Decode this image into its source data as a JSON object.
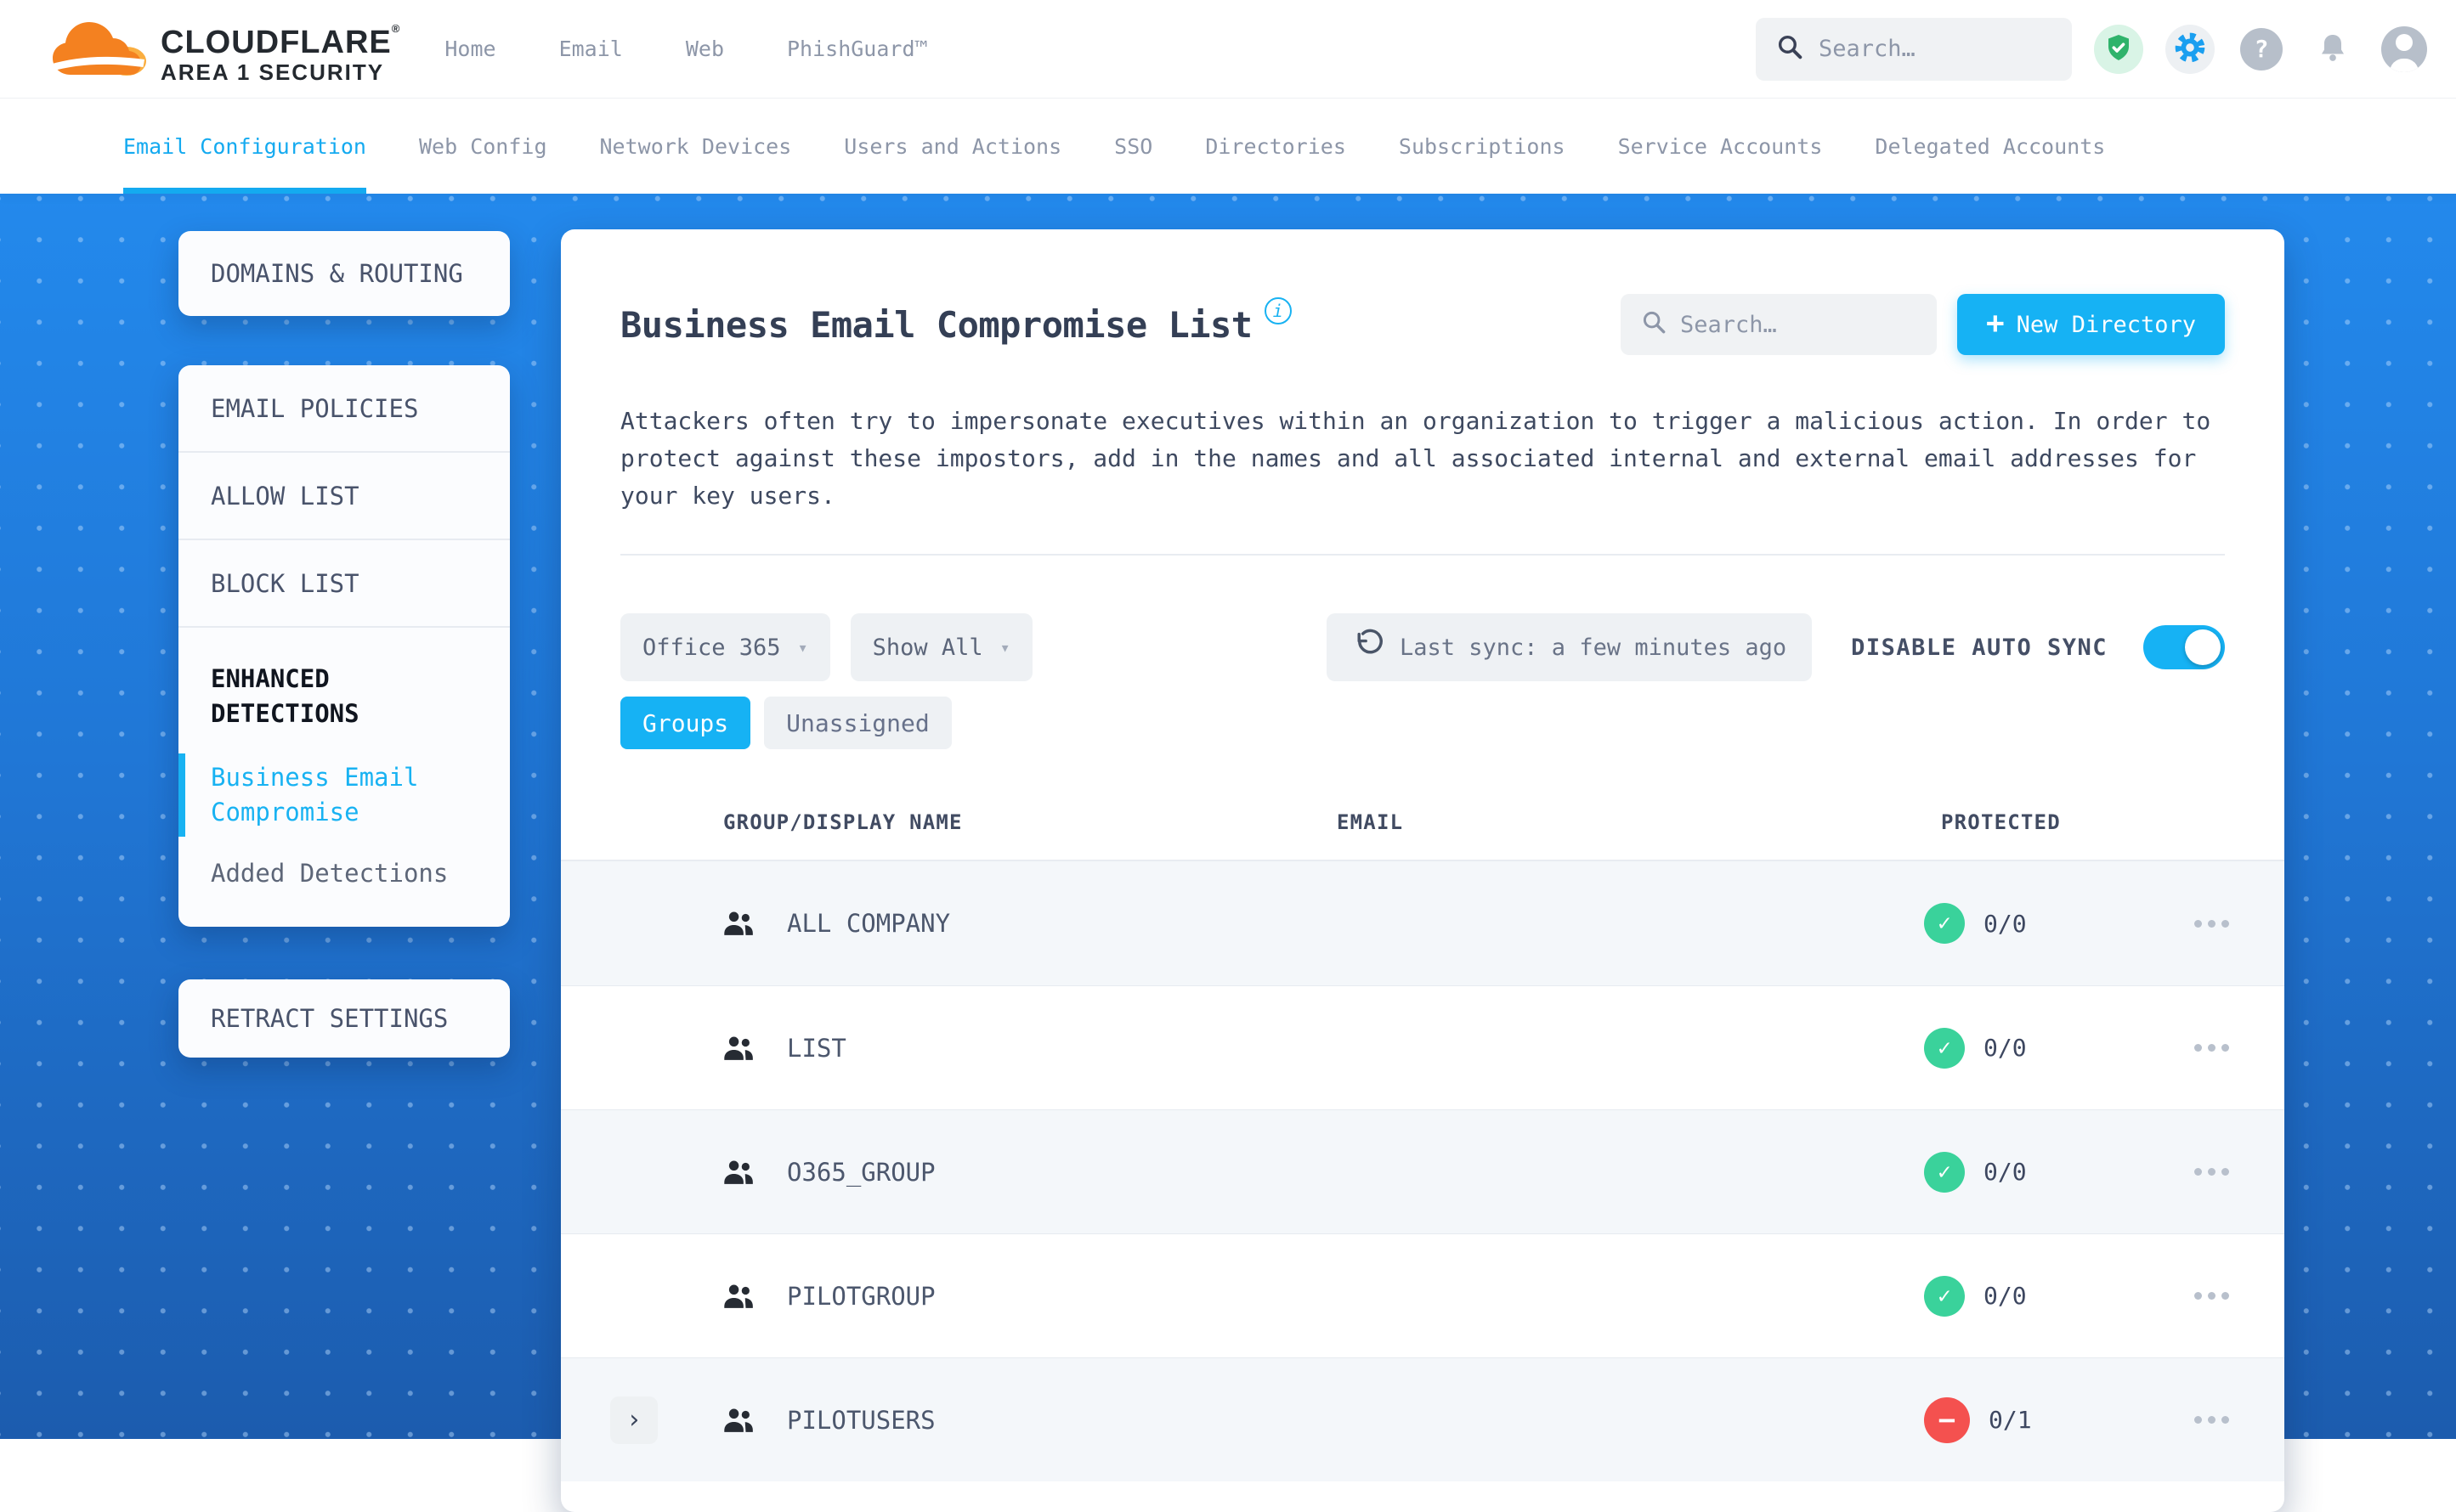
{
  "colors": {
    "accent": "#18b2f2",
    "green": "#3ad29b",
    "red": "#f4514f",
    "bg_top": "#2389ec",
    "bg_bottom": "#1c5cae"
  },
  "icons": {
    "plus": "+",
    "check": "✓",
    "minus": "−",
    "chevron_down": "▾",
    "expander": "›",
    "info": "i",
    "question": "?",
    "reg": "®"
  },
  "topbar": {
    "brand": "CLOUDFLARE",
    "brand_sub": "AREA 1 SECURITY",
    "nav": [
      {
        "label": "Home"
      },
      {
        "label": "Email"
      },
      {
        "label": "Web"
      },
      {
        "label": "PhishGuard™"
      }
    ],
    "search_placeholder": "Search…"
  },
  "tabs": [
    {
      "label": "Email Configuration"
    },
    {
      "label": "Web Config"
    },
    {
      "label": "Network Devices"
    },
    {
      "label": "Users and Actions"
    },
    {
      "label": "SSO"
    },
    {
      "label": "Directories"
    },
    {
      "label": "Subscriptions"
    },
    {
      "label": "Service Accounts"
    },
    {
      "label": "Delegated Accounts"
    }
  ],
  "sidebar": {
    "domains_routing": "DOMAINS & ROUTING",
    "email_policies": "EMAIL POLICIES",
    "allow_list": "ALLOW LIST",
    "block_list": "BLOCK LIST",
    "enhanced_detections": "ENHANCED DETECTIONS",
    "business_email_compromise": "Business Email Compromise",
    "added_detections": "Added Detections",
    "retract_settings": "RETRACT SETTINGS"
  },
  "main": {
    "title": "Business Email Compromise List",
    "search_placeholder": "Search…",
    "new_directory": "New Directory",
    "description": "Attackers often try to impersonate executives within an organization to trigger a malicious action. In order to protect against these impostors, add in the names and all associated internal and external email addresses for your key users.",
    "filters": {
      "directory": "Office 365",
      "show": "Show All",
      "last_sync": "Last sync: a few minutes ago",
      "auto_sync": "DISABLE AUTO SYNC"
    },
    "chips": [
      {
        "label": "Groups"
      },
      {
        "label": "Unassigned"
      }
    ],
    "table": {
      "col_name": "GROUP/DISPLAY NAME",
      "col_email": "EMAIL",
      "col_protected": "PROTECTED",
      "rows": [
        {
          "name": "ALL COMPANY",
          "email": "",
          "protected": "0/0"
        },
        {
          "name": "LIST",
          "email": "",
          "protected": "0/0"
        },
        {
          "name": "O365_GROUP",
          "email": "",
          "protected": "0/0"
        },
        {
          "name": "PILOTGROUP",
          "email": "",
          "protected": "0/0"
        },
        {
          "name": "PILOTUSERS",
          "email": "",
          "protected": "0/1"
        }
      ]
    }
  }
}
